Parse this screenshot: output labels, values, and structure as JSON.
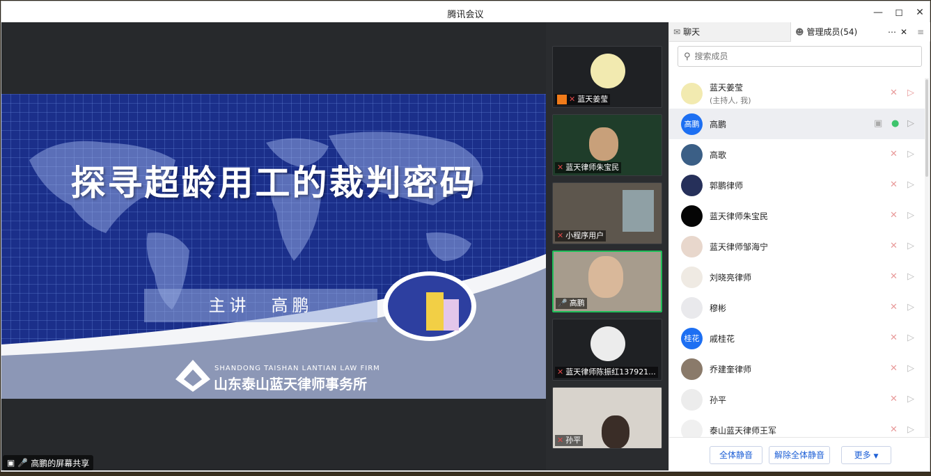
{
  "window": {
    "title": "腾讯会议"
  },
  "slide": {
    "title": "探寻超龄用工的裁判密码",
    "presenter": "主讲　高鹏",
    "firm_en": "SHANDONG TAISHAN LANTIAN LAW FIRM",
    "firm_cn": "山东泰山蓝天律师事务所"
  },
  "share_status": "高鹏的屏幕共享",
  "thumbnails": [
    {
      "name": "蓝天姜莹"
    },
    {
      "name": "蓝天律师朱宝民"
    },
    {
      "name": "小程序用户"
    },
    {
      "name": "高鹏"
    },
    {
      "name": "蓝天律师陈振红137921..."
    },
    {
      "name": "孙平"
    }
  ],
  "panel": {
    "tab_chat": "聊天",
    "tab_members": "管理成员(54)",
    "search_placeholder": "搜索成员",
    "members": [
      {
        "name": "蓝天姜莹",
        "sub": "(主持人, 我)"
      },
      {
        "name": "高鹏",
        "avatar_text": "高鹏"
      },
      {
        "name": "高歌"
      },
      {
        "name": "郭鹏律师"
      },
      {
        "name": "蓝天律师朱宝民"
      },
      {
        "name": "蓝天律师邹海宁"
      },
      {
        "name": "刘晓亮律师"
      },
      {
        "name": "穆彬"
      },
      {
        "name": "戚桂花",
        "avatar_text": "桂花"
      },
      {
        "name": "乔建奎律师"
      },
      {
        "name": "孙平"
      },
      {
        "name": "泰山蓝天律师王军"
      }
    ],
    "buttons": {
      "mute_all": "全体静音",
      "unmute_all": "解除全体静音",
      "more": "更多"
    }
  },
  "colors": {
    "accent": "#1d5fd6",
    "active_border": "#1fbf5a",
    "slide_bg": "#1b2f8a"
  }
}
